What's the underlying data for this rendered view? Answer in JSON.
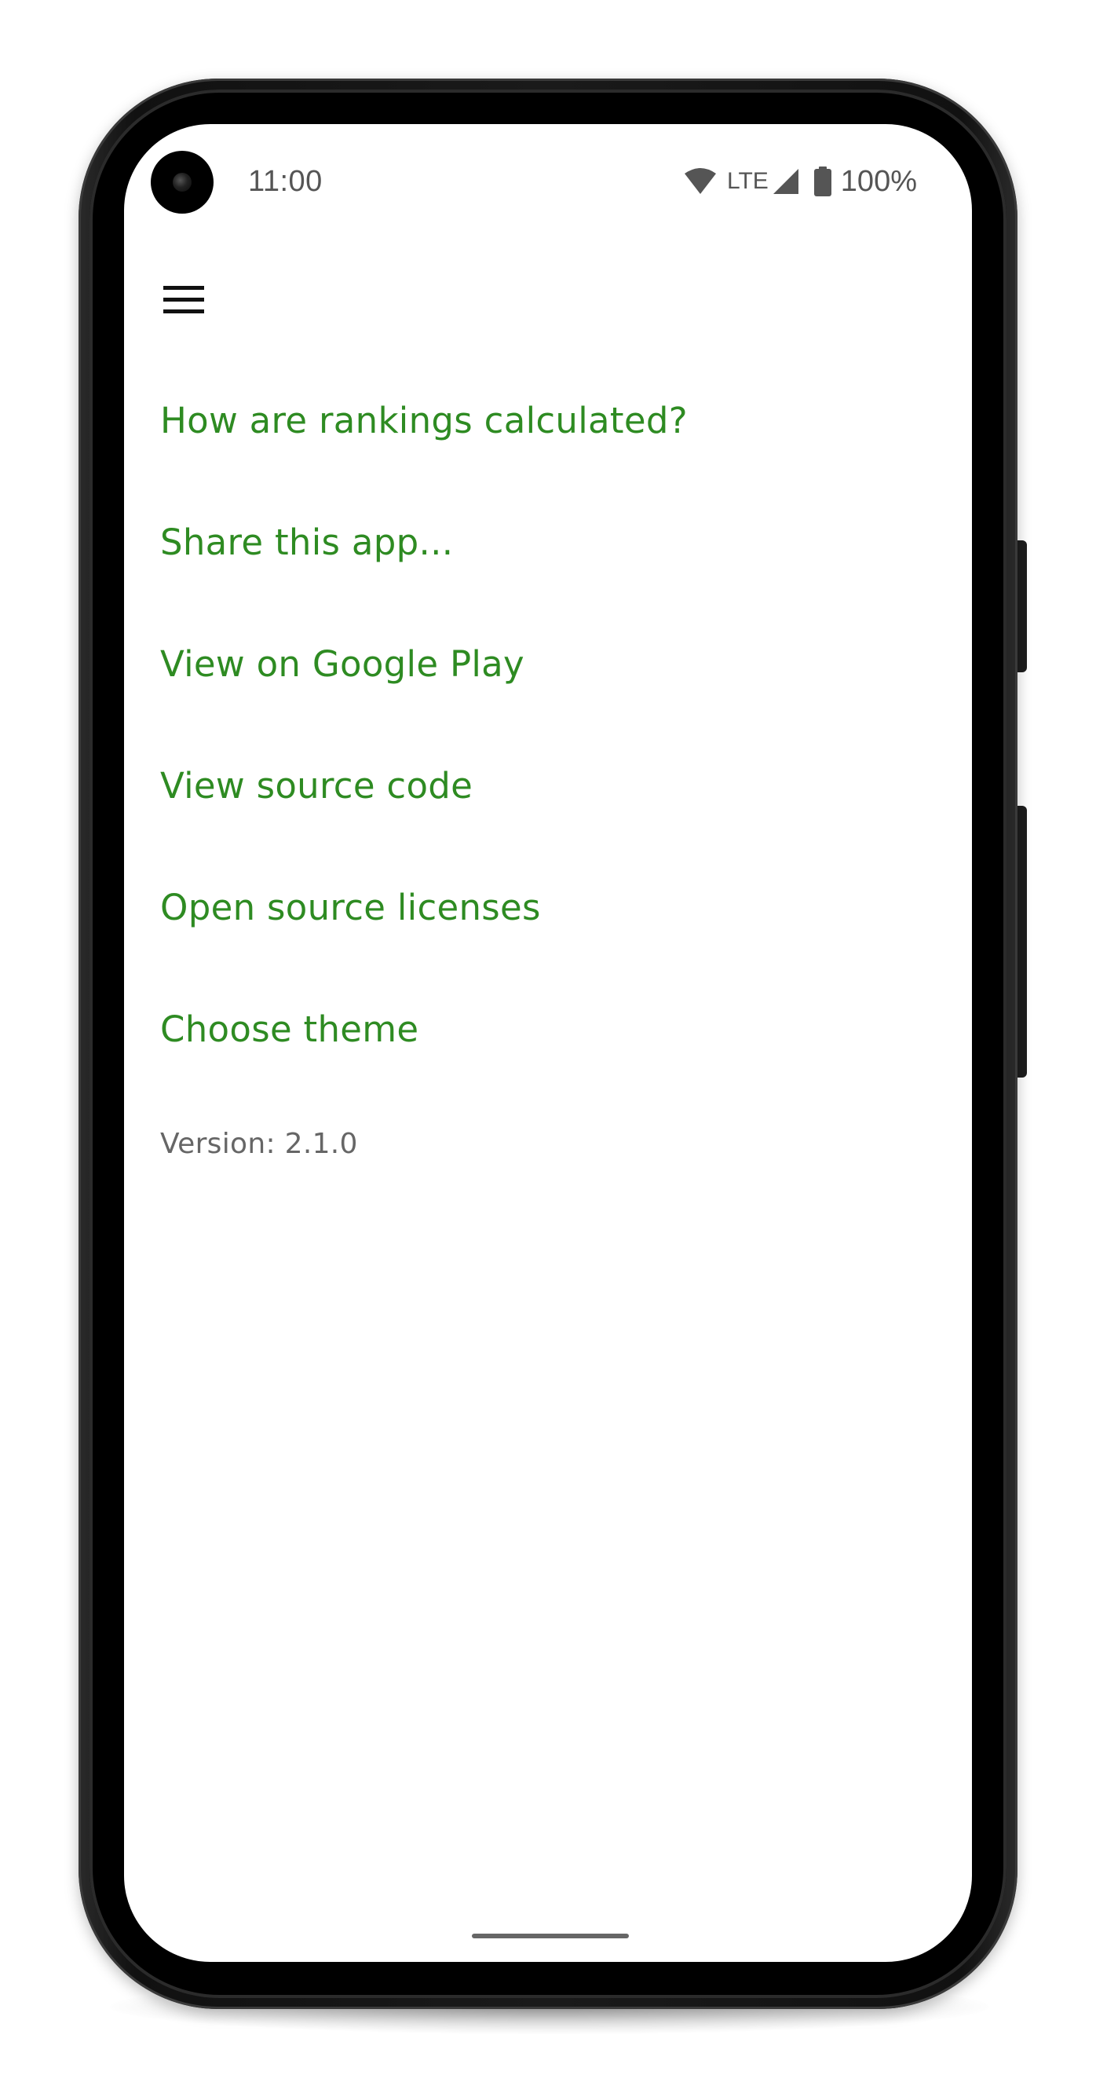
{
  "status_bar": {
    "time": "11:00",
    "network": "LTE",
    "battery": "100%",
    "icons": [
      "wifi-icon",
      "cell-signal-icon",
      "battery-icon"
    ]
  },
  "toolbar": {
    "menu_icon": "hamburger-menu-icon"
  },
  "menu": {
    "items": [
      {
        "label": "How are rankings calculated?"
      },
      {
        "label": "Share this app..."
      },
      {
        "label": "View on Google Play"
      },
      {
        "label": "View source code"
      },
      {
        "label": "Open source licenses"
      },
      {
        "label": "Choose theme"
      }
    ]
  },
  "footer": {
    "version": "Version: 2.1.0"
  },
  "colors": {
    "accent": "#2e8b22",
    "secondary_text": "#666666",
    "status_text": "#555555",
    "background": "#ffffff"
  }
}
